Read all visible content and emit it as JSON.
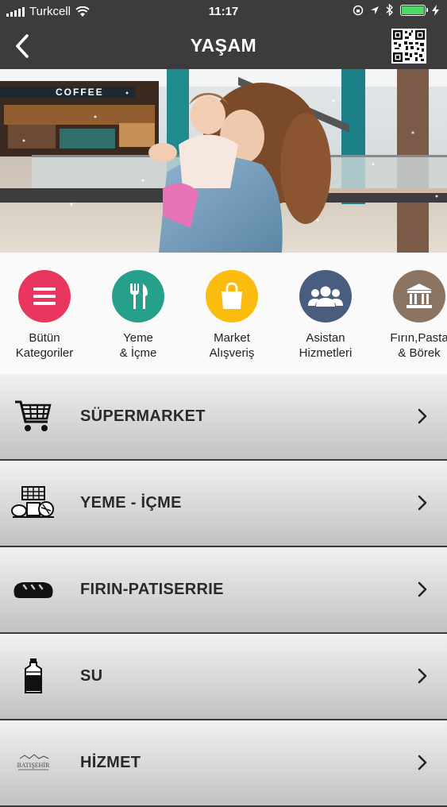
{
  "status_bar": {
    "carrier": "Turkcell",
    "time": "11:17"
  },
  "header": {
    "title": "YAŞAM",
    "back_icon": "chevron-left-icon",
    "qr_icon": "qr-code-icon"
  },
  "hero": {
    "sign_text": "COFFEE"
  },
  "categories": [
    {
      "line1": "Bütün",
      "line2": "Kategoriler",
      "color": "#e8365f",
      "icon": "list-icon"
    },
    {
      "line1": "Yeme",
      "line2": "& İçme",
      "color": "#26a08a",
      "icon": "fork-knife-icon"
    },
    {
      "line1": "Market",
      "line2": "Alışveriş",
      "color": "#fbbc0f",
      "icon": "shopping-bag-icon"
    },
    {
      "line1": "Asistan",
      "line2": "Hizmetleri",
      "color": "#4a5d7e",
      "icon": "people-icon"
    },
    {
      "line1": "Fırın,Pasta",
      "line2": "& Börek",
      "color": "#8c7462",
      "icon": "bank-icon"
    }
  ],
  "list": [
    {
      "label": "SÜPERMARKET",
      "icon": "shopping-cart-icon"
    },
    {
      "label": "YEME - İÇME",
      "icon": "food-basket-icon"
    },
    {
      "label": "FIRIN-PATISERRIE",
      "icon": "bread-icon"
    },
    {
      "label": "SU",
      "icon": "water-bottle-icon"
    },
    {
      "label": "HİZMET",
      "icon": "batisehir-logo-icon",
      "logo_text": "BATIŞEHİR"
    }
  ],
  "colors": {
    "bar_bg": "#3c3c3c",
    "battery": "#4cd964"
  }
}
